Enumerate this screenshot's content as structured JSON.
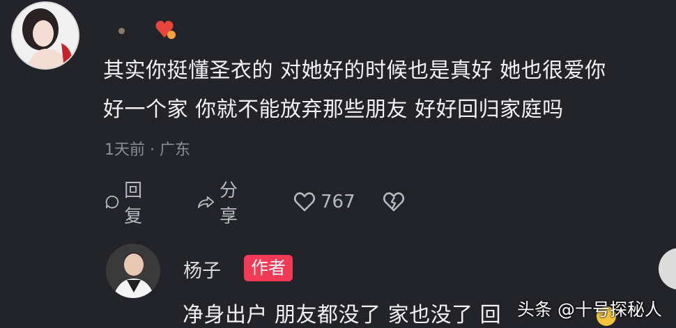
{
  "comment": {
    "line1": "其实你挺懂圣衣的 对她好的时候也是真好 她也很爱你",
    "line2": "好一个家 你就不能放弃那些朋友 好好回归家庭吗",
    "meta": "1天前 · 广东",
    "actions": {
      "reply_label": "回复",
      "share_label": "分享",
      "like_count": "767"
    }
  },
  "reply": {
    "username": "杨子",
    "author_tag": "作者",
    "text": "净身出户 朋友都没了 家也没了 回"
  },
  "watermark": "头条 @十号探秘人",
  "colors": {
    "background": "#232429",
    "author_tag": "#f23a56",
    "badge": "#e8453c"
  },
  "icons": [
    "comment-icon",
    "share-icon",
    "heart-icon",
    "dislike-icon",
    "fan-badge-icon"
  ]
}
